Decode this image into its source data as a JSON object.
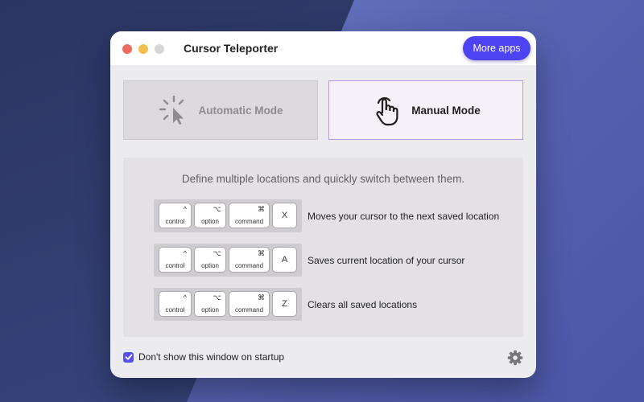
{
  "window": {
    "title": "Cursor Teleporter",
    "more_apps_label": "More apps"
  },
  "modes": {
    "automatic": {
      "label": "Automatic Mode",
      "icon": "cursor-click-icon",
      "selected": false
    },
    "manual": {
      "label": "Manual Mode",
      "icon": "hand-tap-icon",
      "selected": true
    }
  },
  "panel": {
    "description": "Define multiple locations and quickly switch between them.",
    "shortcuts": [
      {
        "keys": [
          {
            "symbol": "^",
            "name": "control"
          },
          {
            "symbol": "⌥",
            "name": "option"
          },
          {
            "symbol": "⌘",
            "name": "command"
          },
          {
            "symbol": "",
            "name": "X"
          }
        ],
        "description": "Moves your cursor to the next saved location"
      },
      {
        "keys": [
          {
            "symbol": "^",
            "name": "control"
          },
          {
            "symbol": "⌥",
            "name": "option"
          },
          {
            "symbol": "⌘",
            "name": "command"
          },
          {
            "symbol": "",
            "name": "A"
          }
        ],
        "description": "Saves current location of your cursor"
      },
      {
        "keys": [
          {
            "symbol": "^",
            "name": "control"
          },
          {
            "symbol": "⌥",
            "name": "option"
          },
          {
            "symbol": "⌘",
            "name": "command"
          },
          {
            "symbol": "",
            "name": "Z"
          }
        ],
        "description": "Clears all saved locations"
      }
    ]
  },
  "footer": {
    "startup_label": "Don't show this window on startup",
    "startup_checked": true,
    "settings_icon": "gear-icon"
  },
  "colors": {
    "accent": "#4d43f2",
    "manual_border": "#b29be0"
  }
}
